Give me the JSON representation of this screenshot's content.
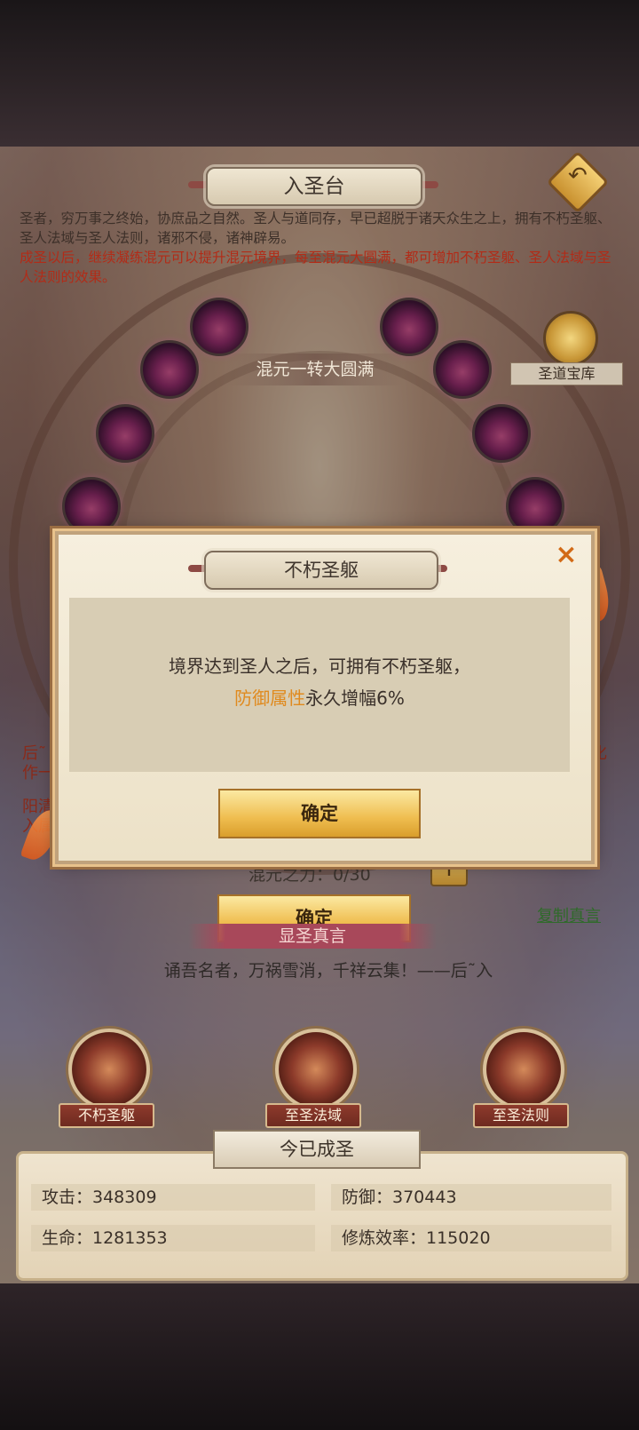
{
  "colors": {
    "accent_red": "#b22b17",
    "highlight_orange": "#e08a1e",
    "link_green": "#2f6a2a"
  },
  "header": {
    "title": "入圣台"
  },
  "intro": {
    "line1": "圣者，穷万事之终始，协庶品之自然。圣人与道同存，早已超脱于诸天众生之上，拥有不朽圣躯、圣人法域与圣人法则，诸邪不侵，诸神辟易。",
    "line2": "成圣以后，继续凝练混元可以提升混元境界，每至混元大圆满，都可增加不朽圣躯、圣人法域与圣人法则的效果。"
  },
  "treasury_label": "圣道宝库",
  "realm_label": "混元一转大圆满",
  "partial_text": {
    "left_a": "后˜",
    "left_b": "作一",
    "left_c": "阳清",
    "left_d": "入属",
    "right_a": "化"
  },
  "force": {
    "label": "混元之力：0/30",
    "plus": "+"
  },
  "confirm_under": "确定",
  "copy_link": "复制真言",
  "mantra": {
    "banner": "显圣真言",
    "text": "诵吾名者，万祸雪消，千祥云集！——后˜入"
  },
  "skills": [
    {
      "label": "不朽圣躯"
    },
    {
      "label": "至圣法域"
    },
    {
      "label": "至圣法则"
    }
  ],
  "status_title": "今已成圣",
  "stats": {
    "attack": "攻击：348309",
    "defense": "防御：370443",
    "hp": "生命：1281353",
    "cultivation": "修炼效率：115020"
  },
  "modal": {
    "title": "不朽圣躯",
    "close": "×",
    "line1": "境界达到圣人之后，可拥有不朽圣躯，",
    "highlight": "防御属性",
    "line2_rest": "永久增幅6%",
    "confirm": "确定"
  }
}
